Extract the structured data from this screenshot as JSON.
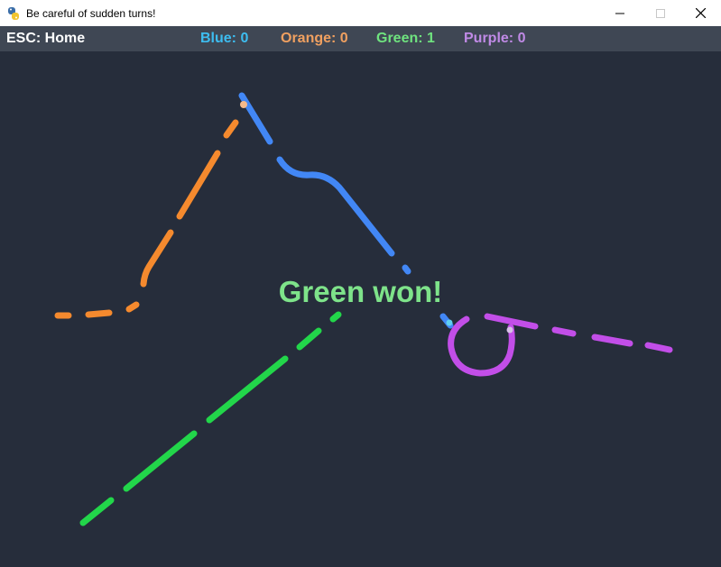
{
  "window": {
    "title": "Be careful of sudden turns!"
  },
  "hud": {
    "home_hint": "ESC: Home",
    "scores": [
      {
        "label": "Blue: 0",
        "color": "#3dbdf0"
      },
      {
        "label": "Orange: 0",
        "color": "#f0a060"
      },
      {
        "label": "Green: 1",
        "color": "#6fe37f"
      },
      {
        "label": "Purple: 0",
        "color": "#c08ae6"
      }
    ]
  },
  "game": {
    "message": "Green won!",
    "message_color": "#7ee38a",
    "trail_colors": {
      "blue": "#4287f5",
      "orange": "#f58a2e",
      "green": "#22d64a",
      "purple": "#c24ee8"
    }
  }
}
